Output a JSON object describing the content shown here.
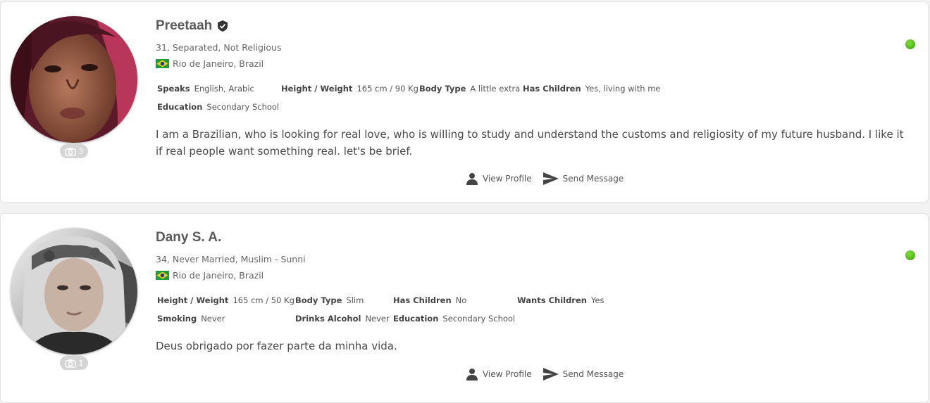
{
  "profiles": [
    {
      "name": "Preetaah",
      "verified_icon": "verified-shield-icon",
      "summary": "31, Separated, Not Religious",
      "location": "Rio de Janeiro, Brazil",
      "flag": "brazil-flag-icon",
      "attributes": [
        {
          "label": "Speaks",
          "value": "English, Arabic"
        },
        {
          "label": "Height / Weight",
          "value": "165 cm / 90 Kg"
        },
        {
          "label": "Body Type",
          "value": "A little extra"
        },
        {
          "label": "Has Children",
          "value": "Yes, living with me"
        },
        {
          "label": "Education",
          "value": "Secondary School"
        }
      ],
      "bio": "I am a Brazilian, who is looking for real love, who is willing to study and understand the customs and religiosity of my future husband. I like it if real people want something real. let's be brief.",
      "photo_count": "3",
      "online": true,
      "actions": {
        "view_profile": "View Profile",
        "send_message": "Send Message"
      }
    },
    {
      "name": "Dany S. A.",
      "summary": "34, Never Married, Muslim - Sunni",
      "location": "Rio de Janeiro, Brazil",
      "flag": "brazil-flag-icon",
      "attributes": [
        {
          "label": "Height / Weight",
          "value": "165 cm / 50 Kg"
        },
        {
          "label": "Body Type",
          "value": "Slim"
        },
        {
          "label": "Has Children",
          "value": "No"
        },
        {
          "label": "Wants Children",
          "value": "Yes"
        },
        {
          "label": "Smoking",
          "value": "Never"
        },
        {
          "label": "Drinks Alcohol",
          "value": "Never"
        },
        {
          "label": "Education",
          "value": "Secondary School"
        }
      ],
      "bio": "Deus obrigado por fazer parte da minha vida.",
      "photo_count": "1",
      "online": true,
      "actions": {
        "view_profile": "View Profile",
        "send_message": "Send Message"
      }
    }
  ],
  "colors": {
    "online": "#4caf12",
    "text": "#444444",
    "card_border": "#e2e2e2"
  }
}
